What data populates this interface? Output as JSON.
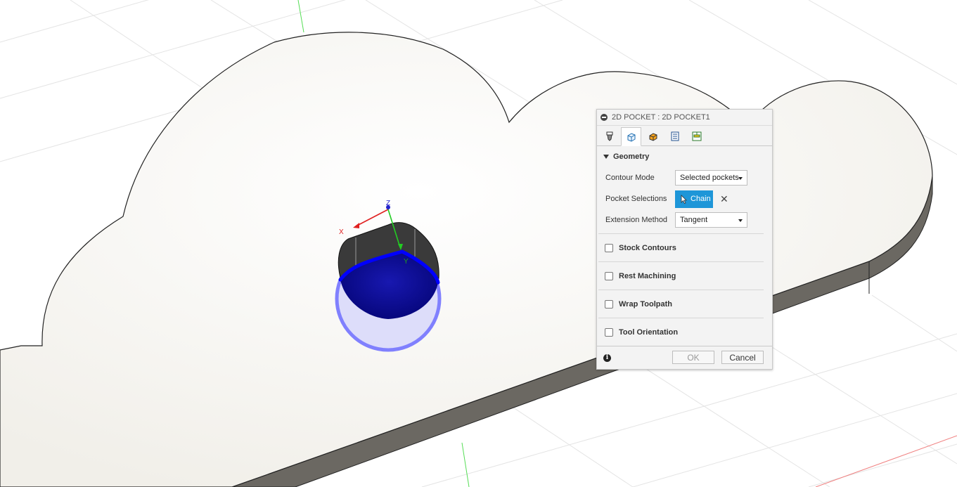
{
  "dialog": {
    "title": "2D POCKET : 2D POCKET1",
    "tabs": [
      {
        "icon": "tool-icon",
        "active": false
      },
      {
        "icon": "geometry-icon",
        "active": true
      },
      {
        "icon": "heights-icon",
        "active": false
      },
      {
        "icon": "passes-icon",
        "active": false
      },
      {
        "icon": "linking-icon",
        "active": false
      }
    ],
    "geometry": {
      "section_label": "Geometry",
      "contour_mode_label": "Contour Mode",
      "contour_mode_value": "Selected pockets",
      "pocket_selections_label": "Pocket Selections",
      "chain_label": "Chain",
      "extension_method_label": "Extension Method",
      "extension_method_value": "Tangent"
    },
    "options": {
      "stock_contours": "Stock Contours",
      "rest_machining": "Rest Machining",
      "wrap_toolpath": "Wrap Toolpath",
      "tool_orientation": "Tool Orientation"
    },
    "footer": {
      "ok_label": "OK",
      "cancel_label": "Cancel"
    }
  },
  "viewport": {
    "axes": {
      "x_label": "X",
      "y_label": "Y",
      "z_label": "Z"
    },
    "colors": {
      "part_face": "#f7f6f2",
      "part_side": "#6b6862",
      "pocket_fill": "#0b0b96",
      "pocket_outline": "#0000ff",
      "selection_glow": "#8a8aff",
      "grid": "#e2e2e2",
      "axis_x": "#e02020",
      "axis_y": "#22cc22",
      "axis_z": "#2222cc"
    }
  }
}
